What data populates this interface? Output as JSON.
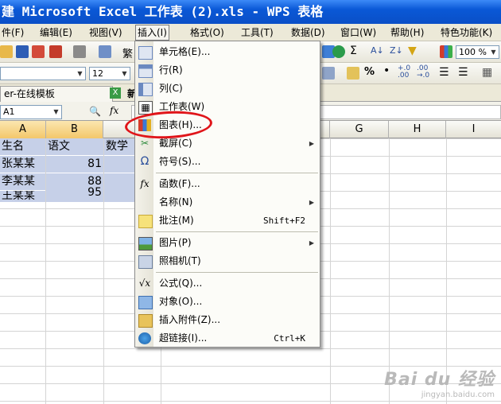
{
  "window": {
    "title": "建 Microsoft Excel 工作表 (2).xls - WPS 表格"
  },
  "menubar": [
    {
      "label": "件(F)"
    },
    {
      "label": "编辑(E)"
    },
    {
      "label": "视图(V)"
    },
    {
      "label": "插入(I)"
    },
    {
      "label": "格式(O)"
    },
    {
      "label": "工具(T)"
    },
    {
      "label": "数据(D)"
    },
    {
      "label": "窗口(W)"
    },
    {
      "label": "帮助(H)"
    },
    {
      "label": "特色功能(K)"
    }
  ],
  "toolbar1": {
    "traditional_label": "繁",
    "zoom": "100 %"
  },
  "toolbar2": {
    "font_size": "12",
    "percent_label": "%"
  },
  "tabs": [
    {
      "label": "er-在线模板"
    },
    {
      "label": "新"
    }
  ],
  "formula_bar": {
    "cell_ref": "A1",
    "fx_label": "fx"
  },
  "columns": [
    "A",
    "B",
    "G",
    "H",
    "I"
  ],
  "cells": {
    "row1": [
      "生名",
      "语文",
      "数学"
    ],
    "row2": [
      "张某某",
      "81"
    ],
    "row3": [
      "李某某",
      "88"
    ],
    "row4": [
      "王某某",
      "95"
    ]
  },
  "insert_menu": [
    {
      "label": "单元格(E)...",
      "icon": "cell-icon"
    },
    {
      "label": "行(R)",
      "icon": "row-icon"
    },
    {
      "label": "列(C)",
      "icon": "column-icon"
    },
    {
      "label": "工作表(W)",
      "icon": "worksheet-icon"
    },
    {
      "label": "图表(H)...",
      "icon": "chart-icon"
    },
    {
      "label": "截屏(C)",
      "icon": "screenshot-icon"
    },
    {
      "label": "符号(S)...",
      "icon": "omega-icon"
    },
    {
      "label": "函数(F)...",
      "icon": "function-icon"
    },
    {
      "label": "名称(N)",
      "icon": "name-icon"
    },
    {
      "label": "批注(M)",
      "shortcut": "Shift+F2",
      "icon": "comment-icon"
    },
    {
      "label": "图片(P)",
      "icon": "picture-icon"
    },
    {
      "label": "照相机(T)",
      "icon": "camera-icon"
    },
    {
      "label": "公式(Q)...",
      "icon": "formula-icon"
    },
    {
      "label": "对象(O)...",
      "icon": "object-icon"
    },
    {
      "label": "插入附件(Z)...",
      "icon": "attachment-icon"
    },
    {
      "label": "超链接(I)...",
      "shortcut": "Ctrl+K",
      "icon": "hyperlink-icon"
    }
  ],
  "watermark": {
    "brand": "Bai du 经验",
    "url": "jingyan.baidu.com"
  },
  "colors": {
    "title_bar": "#0a58d6",
    "selection": "#c6d0e8",
    "highlight_circle": "#e0151a"
  }
}
